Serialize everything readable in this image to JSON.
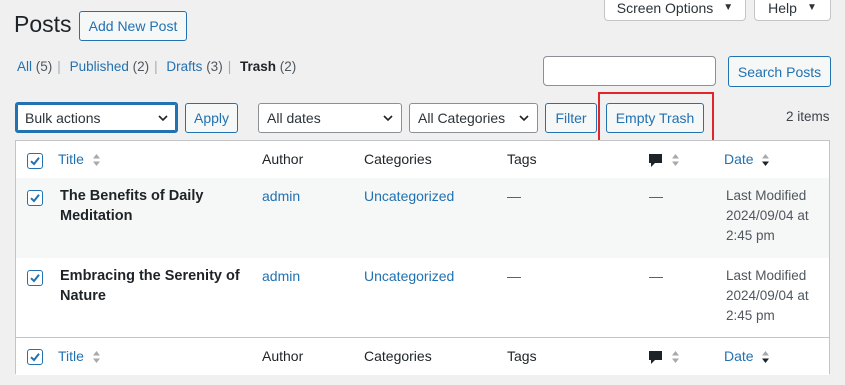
{
  "header": {
    "title": "Posts",
    "add_new": "Add New Post",
    "screen_options": "Screen Options",
    "help": "Help"
  },
  "views": {
    "all_label": "All",
    "all_count": "(5)",
    "published_label": "Published",
    "published_count": "(2)",
    "drafts_label": "Drafts",
    "drafts_count": "(3)",
    "trash_label": "Trash",
    "trash_count": "(2)",
    "separator": "|"
  },
  "search": {
    "value": "",
    "button": "Search Posts"
  },
  "toolbar": {
    "bulk_actions": "Bulk actions",
    "apply": "Apply",
    "dates": "All dates",
    "categories": "All Categories",
    "filter": "Filter",
    "empty_trash": "Empty Trash",
    "items_count": "2 items"
  },
  "columns": {
    "title": "Title",
    "author": "Author",
    "categories": "Categories",
    "tags": "Tags",
    "date": "Date"
  },
  "rows": [
    {
      "title_line1": "The Benefits of Daily",
      "title_line2": "Meditation",
      "author": "admin",
      "category": "Uncategorized",
      "tags": "—",
      "comments": "—",
      "date_line1": "Last Modified",
      "date_line2": "2024/09/04 at",
      "date_line3": "2:45 pm"
    },
    {
      "title_line1": "Embracing the Serenity of",
      "title_line2": "Nature",
      "author": "admin",
      "category": "Uncategorized",
      "tags": "—",
      "comments": "—",
      "date_line1": "Last Modified",
      "date_line2": "2024/09/04 at",
      "date_line3": "2:45 pm"
    }
  ],
  "colors": {
    "link": "#2271b1",
    "highlight": "#e0262a",
    "background": "#f0f0f1"
  },
  "icons": {
    "checkbox": "checkmark-icon",
    "comments": "comment-bubble-icon",
    "sort": "sort-arrows-icon",
    "dropdown": "chevron-down-icon"
  }
}
